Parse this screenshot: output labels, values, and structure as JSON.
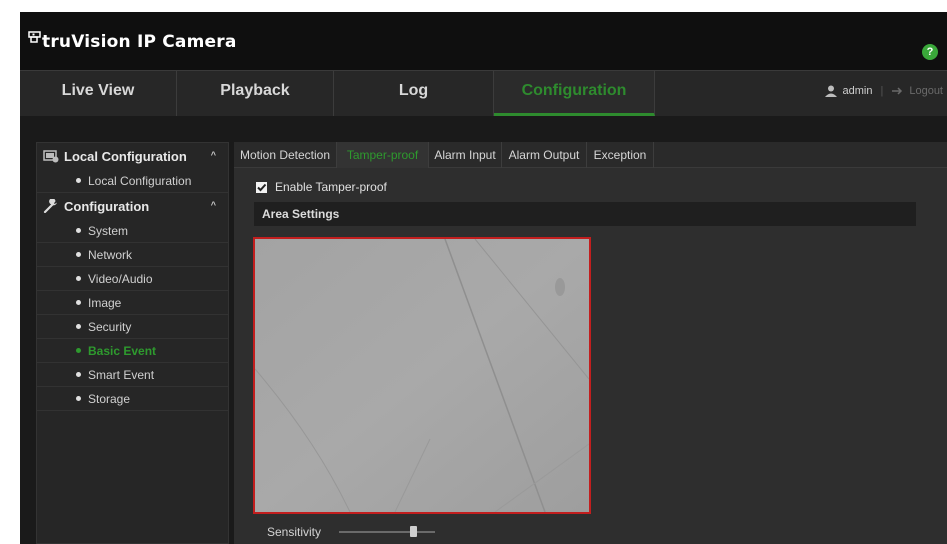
{
  "app": {
    "brand": "truVision IP Camera",
    "help_icon": "help-icon"
  },
  "nav": {
    "tabs": [
      {
        "label": "Live View"
      },
      {
        "label": "Playback"
      },
      {
        "label": "Log"
      },
      {
        "label": "Configuration",
        "active": true
      }
    ],
    "user": "admin",
    "separator": "|",
    "logout": "Logout"
  },
  "sidebar": {
    "groups": [
      {
        "label": "Local Configuration",
        "icon": "local-config-icon",
        "caret": "^",
        "items": [
          "Local Configuration"
        ]
      },
      {
        "label": "Configuration",
        "icon": "wrench-icon",
        "caret": "^",
        "items": [
          "System",
          "Network",
          "Video/Audio",
          "Image",
          "Security",
          "Basic Event",
          "Smart Event",
          "Storage"
        ]
      }
    ],
    "active_item": "Basic Event"
  },
  "sub_tabs": [
    "Motion Detection",
    "Tamper-proof",
    "Alarm Input",
    "Alarm Output",
    "Exception"
  ],
  "active_sub_tab": "Tamper-proof",
  "tamper": {
    "enable_label": "Enable Tamper-proof",
    "enabled": true,
    "area_settings_title": "Area Settings",
    "sensitivity_label": "Sensitivity",
    "sensitivity_value": 0.8
  },
  "colors": {
    "accent": "#2e9a2e",
    "area_border": "#c21e1e"
  }
}
